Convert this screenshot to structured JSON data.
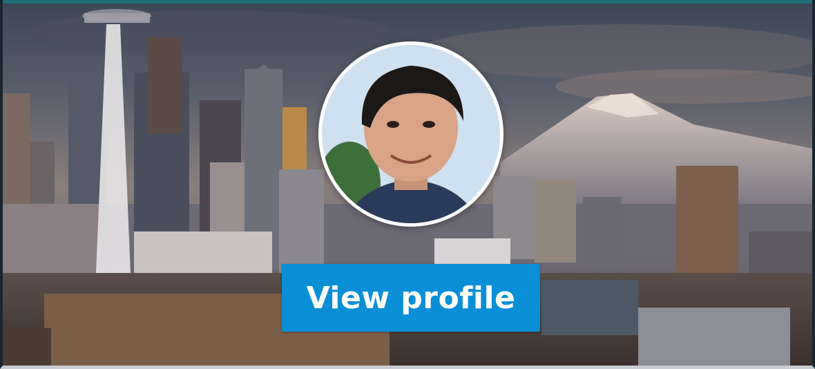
{
  "profile_card": {
    "cover_photo": "seattle-skyline-photo",
    "avatar": "profile-photo",
    "view_profile_label": "View profile"
  },
  "colors": {
    "button": "#0a8fd6",
    "button_text": "#ffffff",
    "top_accent": "#1f6f78"
  }
}
